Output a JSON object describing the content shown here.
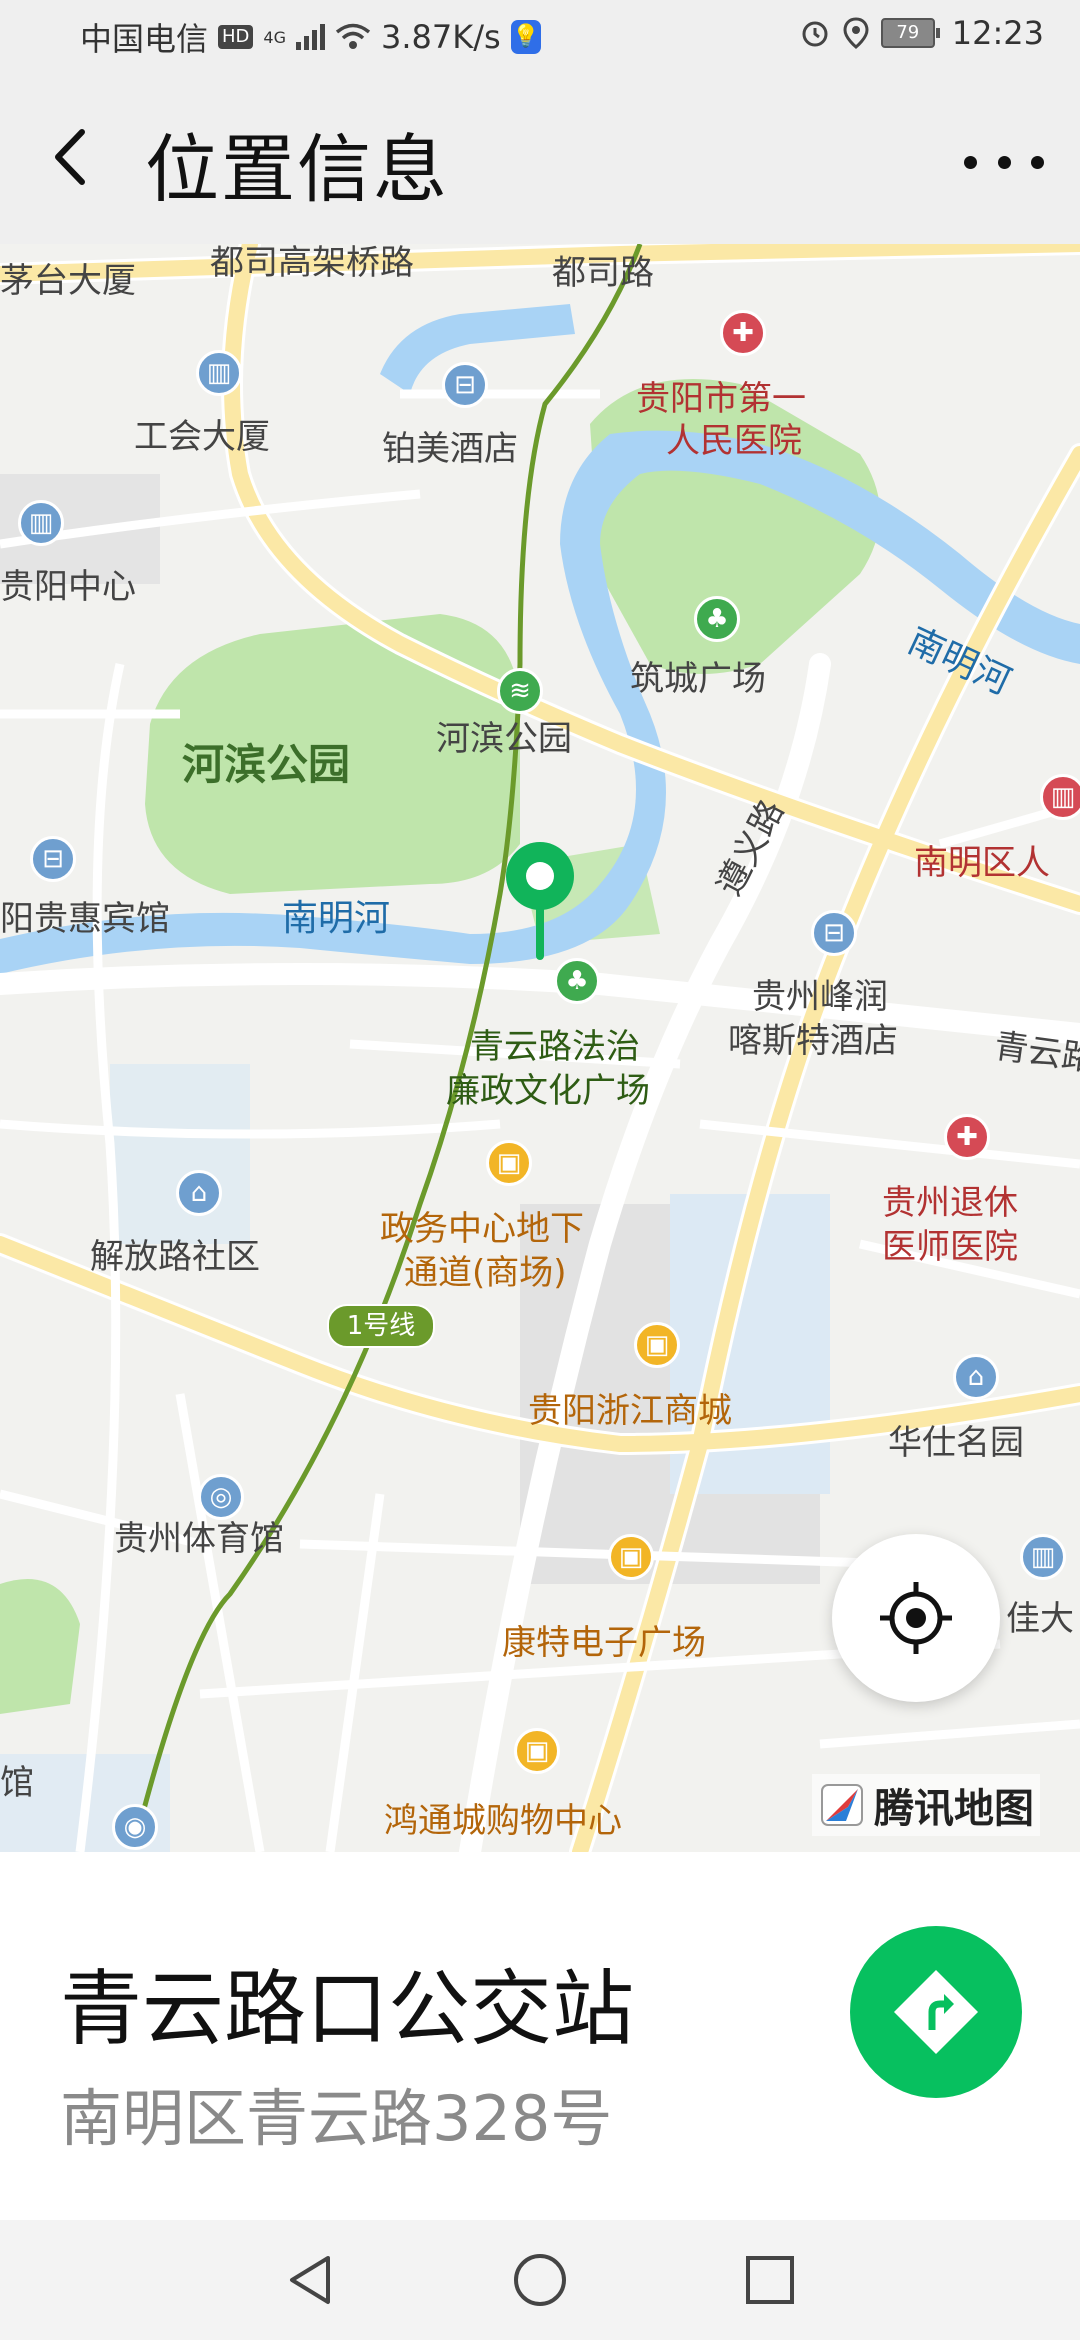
{
  "status_bar": {
    "carrier": "中国电信",
    "hd_badge": "HD",
    "network_type": "4G",
    "speed": "3.87K/s",
    "battery_level": "79",
    "time": "12:23",
    "icons": [
      "signal-icon",
      "wifi-icon",
      "bulb-app-icon",
      "alarm-icon",
      "location-icon",
      "battery-icon"
    ]
  },
  "header": {
    "title": "位置信息",
    "back_icon": "chevron-left-icon",
    "more_icon": "more-icon"
  },
  "map": {
    "labels": {
      "maotai": "茅台大厦",
      "dusi_elevated": "都司高架桥路",
      "dusi_road": "都司路",
      "hospital1": "贵阳市第一",
      "hospital1b": "人民医院",
      "union": "工会大厦",
      "bomei": "铂美酒店",
      "guiyang_center": "贵阳中心",
      "nanming_river_ne": "南明河",
      "zhucheng": "筑城广场",
      "hebin_station": "河滨公园",
      "hebin_park": "河滨公园",
      "nanming_district": "南明区人",
      "guihui": "阳贵惠宾馆",
      "nanming_river": "南明河",
      "zunyi_road": "遵义路",
      "fengrun": "贵州峰润",
      "fengrun_b": "喀斯特酒店",
      "qingyun_edge": "青云路",
      "qingyun_plaza": "青云路法治",
      "qingyun_plaza_b": "廉政文化广场",
      "retire_hospital": "贵州退休",
      "retire_hospital_b": "医师医院",
      "zhengwu": "政务中心地下",
      "zhengwu_b": "通道(商场)",
      "jiefang": "解放路社区",
      "zhejiang_mall": "贵阳浙江商城",
      "huashi": "华仕名园",
      "stadium": "贵州体育馆",
      "kangte": "康特电子广场",
      "jia": "佳大",
      "hongtong": "鸿通城购物中心",
      "guan": "馆"
    },
    "metro_line": "1号线",
    "logo_text": "腾讯地图",
    "locate_icon": "locate-icon",
    "marker_icon": "location-pin-icon"
  },
  "place": {
    "name": "青云路口公交站",
    "address": "南明区青云路328号",
    "nav_icon": "navigation-icon"
  },
  "colors": {
    "accent": "#07c05f",
    "park": "#b9e4a6",
    "river": "#a9d3f5",
    "road": "#fbe8a6"
  }
}
